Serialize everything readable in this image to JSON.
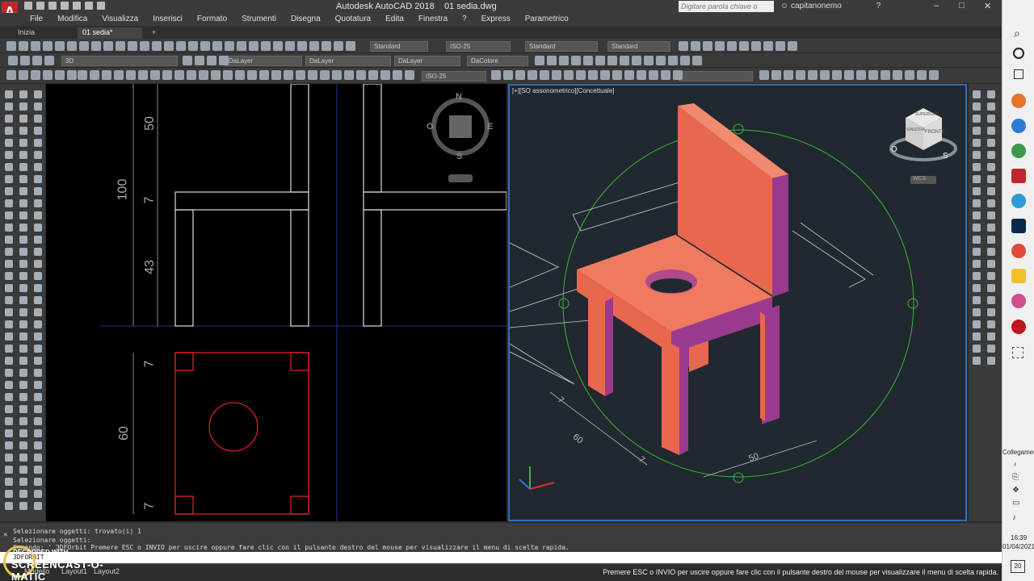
{
  "window": {
    "app_title": "Autodesk AutoCAD 2018",
    "file_name": "01 sedia.dwg",
    "logo_letter": "A",
    "search_placeholder": "Digitare parola chiave o frase",
    "username": "capitanonemo",
    "minimize": "–",
    "maximize": "□",
    "close": "✕"
  },
  "menu": [
    "File",
    "Modifica",
    "Visualizza",
    "Inserisci",
    "Formato",
    "Strumenti",
    "Disegna",
    "Quotatura",
    "Edita",
    "Finestra",
    "?",
    "Express",
    "Parametrico"
  ],
  "tabs": [
    {
      "label": "Inizia",
      "active": false
    },
    {
      "label": "01 sedia*",
      "active": true
    },
    {
      "label": "+",
      "active": false
    }
  ],
  "toolbar": {
    "text_style": "Standard",
    "dim_style": "ISO-25",
    "table_style": "Standard",
    "mleader_style": "Standard",
    "layer": "DaLayer",
    "linetype": "DaLayer",
    "lineweight": "DaLayer",
    "color": "DaColore",
    "workspace": "3D",
    "dim_style_2": "ISO-25"
  },
  "viewport_left": {
    "compass_n": "N",
    "compass_s": "S",
    "compass_e": "E",
    "compass_o": "O",
    "dims": {
      "d50": "50",
      "d100": "100",
      "d7a": "7",
      "d43": "43",
      "d7b": "7",
      "d60": "60",
      "d7c": "7"
    }
  },
  "viewport_right": {
    "label": "[+][SO assonometrico][Concettuale]",
    "viewcube_front": "FRONTE",
    "viewcube_top": "SUPERIORE",
    "viewcube_left": "SINISTRA",
    "compass_o": "O",
    "compass_s": "S",
    "wcs": "WCS",
    "dims": {
      "d7a": "7",
      "d60": "60",
      "d7b": "7",
      "d50": "50"
    }
  },
  "command": {
    "line1": "Selezionare oggetti: trovato(i) 1",
    "line2": "Selezionare oggetti:",
    "line3": "Comando: '_3DFOrbit Premere ESC o INVIO per uscire oppure fare clic con il pulsante destro del mouse per visualizzare il menu di scelta rapida.",
    "input": "3DFORBIT"
  },
  "status": {
    "tab_model": "Modello",
    "tab_layout1": "Layout1",
    "tab_layout2": "Layout2",
    "message": "Premere ESC o INVIO per uscire oppure fare clic con il pulsante destro del mouse per visualizzare il menu di scelta rapida."
  },
  "watermark": {
    "top": "RECORDED WITH",
    "main": "SCREENCAST-O-MATIC"
  },
  "win_panel": {
    "collegamenti": "Collegamer",
    "time": "16:39",
    "date": "01/04/2021",
    "notifications": "20"
  },
  "colors": {
    "chair_face": "#e8674f",
    "chair_side": "#9a3a8e",
    "plan_red": "#e02020",
    "orbit_green": "#3ab83a",
    "viewport_border": "#2f6fb8"
  }
}
